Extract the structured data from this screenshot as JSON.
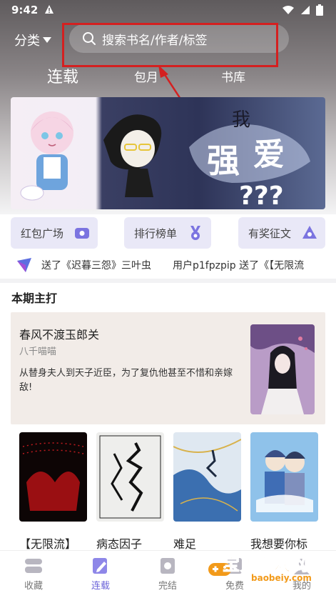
{
  "status_bar": {
    "time": "9:42"
  },
  "header": {
    "category_label": "分类",
    "search_placeholder": "搜索书名/作者/标签",
    "tabs": [
      {
        "label": "连载",
        "active": true
      },
      {
        "label": "包月",
        "active": false
      },
      {
        "label": "书库",
        "active": false
      }
    ]
  },
  "quick_links": [
    {
      "label": "红包广场",
      "icon": "tv-icon"
    },
    {
      "label": "排行榜单",
      "icon": "medal-icon"
    },
    {
      "label": "有奖征文",
      "icon": "triangle-badge-icon"
    }
  ],
  "ticker": {
    "items": [
      "送了《迟暮三怨》三叶虫",
      "用户p1fpzpip 送了《【无限流"
    ]
  },
  "featured": {
    "section_title": "本期主打",
    "title": "春风不渡玉郎关",
    "author": "八千喵喵",
    "description": "从替身夫人到天子近臣，为了复仇他甚至不惜和亲嫁敌!"
  },
  "books": [
    {
      "title": "【无限流】"
    },
    {
      "title": "病态因子"
    },
    {
      "title": "难足"
    },
    {
      "title": "我想要你标"
    }
  ],
  "bottom_nav": [
    {
      "label": "收藏",
      "icon": "bookshelf-icon",
      "active": false
    },
    {
      "label": "连载",
      "icon": "edit-icon",
      "active": true
    },
    {
      "label": "完结",
      "icon": "completed-icon",
      "active": false
    },
    {
      "label": "免费",
      "icon": "free-icon",
      "active": false
    },
    {
      "label": "我的",
      "icon": "profile-icon",
      "active": false
    }
  ],
  "watermark": {
    "cn": "宝贝游戏网",
    "en": "baobeiy.com"
  },
  "colors": {
    "accent": "#6b63d9",
    "highlight": "#d42020",
    "watermark": "#f29a1a"
  }
}
